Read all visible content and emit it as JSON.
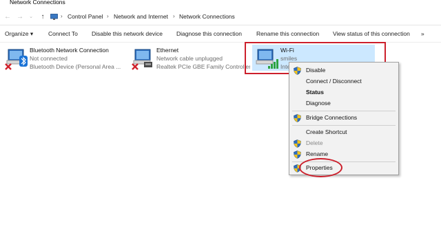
{
  "window": {
    "title": "Network Connections"
  },
  "address": {
    "back_icon": "back-arrow-icon",
    "forward_icon": "forward-arrow-icon",
    "recent_icon": "chevron-down-icon",
    "up_icon": "up-arrow-icon",
    "crumbs": [
      "Control Panel",
      "Network and Internet",
      "Network Connections"
    ]
  },
  "toolbar": {
    "organize": "Organize ▾",
    "connect_to": "Connect To",
    "disable_device": "Disable this network device",
    "diagnose": "Diagnose this connection",
    "rename": "Rename this connection",
    "view_status": "View status of this connection",
    "more": "»"
  },
  "connections": [
    {
      "name": "Bluetooth Network Connection",
      "status": "Not connected",
      "device": "Bluetooth Device (Personal Area ..."
    },
    {
      "name": "Ethernet",
      "status": "Network cable unplugged",
      "device": "Realtek PCIe GBE Family Controller"
    },
    {
      "name": "Wi-Fi",
      "status": "smiles",
      "device": "Inte"
    }
  ],
  "context_menu": {
    "disable": "Disable",
    "connect_disconnect": "Connect / Disconnect",
    "status": "Status",
    "diagnose": "Diagnose",
    "bridge": "Bridge Connections",
    "create_shortcut": "Create Shortcut",
    "delete": "Delete",
    "rename": "Rename",
    "properties": "Properties"
  },
  "colors": {
    "selection": "#cce8ff",
    "annotation_red": "#cc1f2b",
    "menu_bg": "#f2f2f2"
  }
}
